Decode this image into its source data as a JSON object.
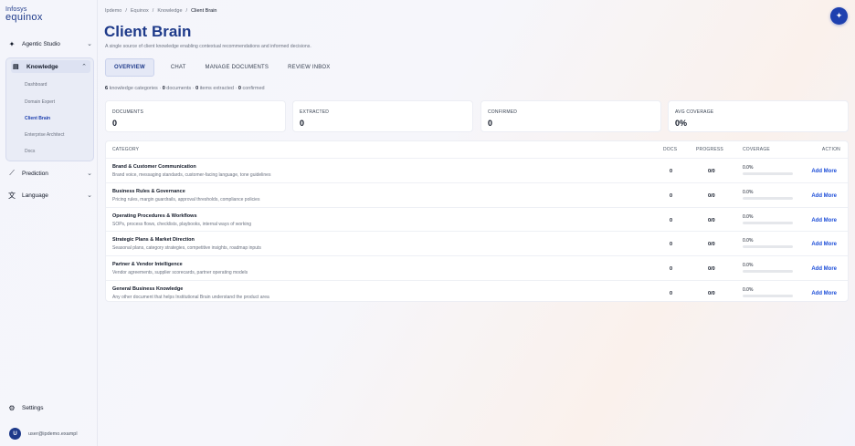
{
  "brand": {
    "line1": "Infosys",
    "line2": "equinox"
  },
  "sidebar": {
    "items": [
      {
        "label": "Agentic Studio",
        "icon": "sparkle-icon"
      },
      {
        "label": "Knowledge",
        "icon": "book-icon"
      },
      {
        "label": "Prediction",
        "icon": "trend-icon"
      },
      {
        "label": "Language",
        "icon": "translate-icon"
      }
    ],
    "knowledge_sub": [
      "Dashboard",
      "Domain Expert",
      "Client Brain",
      "Enterprise Architect",
      "Docs"
    ],
    "active_sub": "Client Brain",
    "settings_label": "Settings",
    "user": {
      "initial": "U",
      "email": "user@ipdemo.exampl"
    }
  },
  "breadcrumb": [
    "Ipdemo",
    "Equinox",
    "Knowledge",
    "Client Brain"
  ],
  "page": {
    "title": "Client Brain",
    "subtitle": "A single source of client knowledge enabling contextual recommendations and informed decisions."
  },
  "tabs": [
    "OVERVIEW",
    "CHAT",
    "MANAGE DOCUMENTS",
    "REVIEW INBOX"
  ],
  "summary": {
    "categories": "6",
    "categories_label": "knowledge categories",
    "documents": "0",
    "documents_label": "documents",
    "extracted": "0",
    "extracted_label": "items extracted",
    "confirmed": "0",
    "confirmed_label": "confirmed"
  },
  "stats": [
    {
      "label": "DOCUMENTS",
      "value": "0"
    },
    {
      "label": "EXTRACTED",
      "value": "0"
    },
    {
      "label": "CONFIRMED",
      "value": "0"
    },
    {
      "label": "AVG COVERAGE",
      "value": "0%"
    }
  ],
  "table": {
    "headers": {
      "category": "CATEGORY",
      "docs": "DOCS",
      "progress": "PROGRESS",
      "coverage": "COVERAGE",
      "action": "ACTION"
    },
    "rows": [
      {
        "name": "Brand & Customer Communication",
        "desc": "Brand voice, messaging standards, customer-facing language, tone guidelines",
        "docs": "0",
        "progress": "0/0",
        "coverage": "0.0%",
        "coverage_value": 0,
        "action": "Add More"
      },
      {
        "name": "Business Rules & Governance",
        "desc": "Pricing rules, margin guardrails, approval thresholds, compliance policies",
        "docs": "0",
        "progress": "0/0",
        "coverage": "0.0%",
        "coverage_value": 0,
        "action": "Add More"
      },
      {
        "name": "Operating Procedures & Workflows",
        "desc": "SOPs, process flows, checklists, playbooks, internal ways of working",
        "docs": "0",
        "progress": "0/0",
        "coverage": "0.0%",
        "coverage_value": 0,
        "action": "Add More"
      },
      {
        "name": "Strategic Plans & Market Direction",
        "desc": "Seasonal plans, category strategies, competitive insights, roadmap inputs",
        "docs": "0",
        "progress": "0/0",
        "coverage": "0.0%",
        "coverage_value": 0,
        "action": "Add More"
      },
      {
        "name": "Partner & Vendor Intelligence",
        "desc": "Vendor agreements, supplier scorecards, partner operating models",
        "docs": "0",
        "progress": "0/0",
        "coverage": "0.0%",
        "coverage_value": 0,
        "action": "Add More"
      },
      {
        "name": "General Business Knowledge",
        "desc": "Any other document that helps Institutional Brain understand the product area",
        "docs": "0",
        "progress": "0/0",
        "coverage": "0.0%",
        "coverage_value": 0,
        "action": "Add More"
      }
    ]
  },
  "colors": {
    "accent": "#1e40af",
    "title": "#1e3a8a",
    "link": "#1d4ed8"
  }
}
